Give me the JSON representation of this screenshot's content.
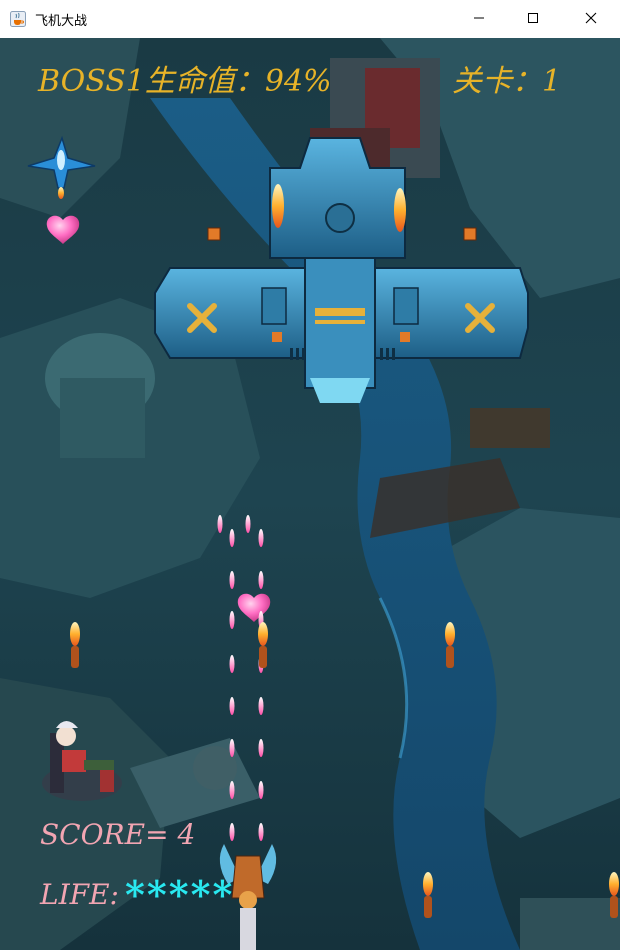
{
  "window": {
    "title": "飞机大战",
    "icon": "java-cup-icon",
    "buttons": [
      "minimize-icon",
      "maximize-icon",
      "close-icon"
    ]
  },
  "hud": {
    "boss_hp_label": "BOSS1生命值：94%",
    "level_label": "关卡：",
    "level_value": "1",
    "score_label": "SCORE= 4",
    "life_label": "LIFE:",
    "life_stars": "*****"
  },
  "colors": {
    "hud_gold": "#e7b328",
    "hud_pink": "#f2a5b2",
    "life_cyan": "#29e8f0",
    "background_teal": "#1f4450"
  }
}
